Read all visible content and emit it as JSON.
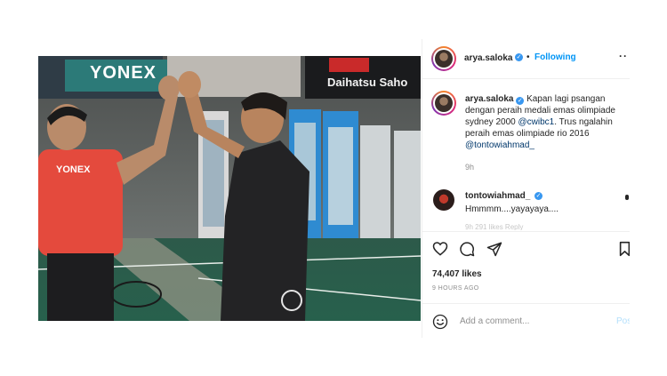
{
  "post": {
    "author": "arya.saloka",
    "follow_status": "Following",
    "separator": "•",
    "more_glyph": "··",
    "verified_glyph": "✓"
  },
  "photo": {
    "banner_brand": "YONEX",
    "banner_sponsor": "Daihatsu Saho",
    "shirt_brand": "YONEX",
    "description_colors": {
      "shirt": "#e8483c",
      "floor": "#2f6b55",
      "wall": "#6d7370"
    }
  },
  "caption": {
    "author": "arya.saloka",
    "text_before": "Kapan lagi psangan dengan peraih medali emas olimpiade sydney 2000",
    "mention1": "@cwibc1",
    "text_mid": ". Trus ngalahin peraih emas olimpiade rio 2016",
    "mention2": "@tontowiahmad_",
    "time": "9h"
  },
  "reply": {
    "author": "tontowiahmad_",
    "text": "Hmmmm....yayayaya....",
    "meta_faded": "9h 291 likes Reply"
  },
  "actions": {
    "icons": [
      "heart-icon",
      "comment-icon",
      "share-icon",
      "bookmark-icon"
    ],
    "likes": "74,407 likes",
    "time_ago": "9 HOURS AGO"
  },
  "comment_box": {
    "placeholder": "Add a comment...",
    "post_label": "Post"
  }
}
